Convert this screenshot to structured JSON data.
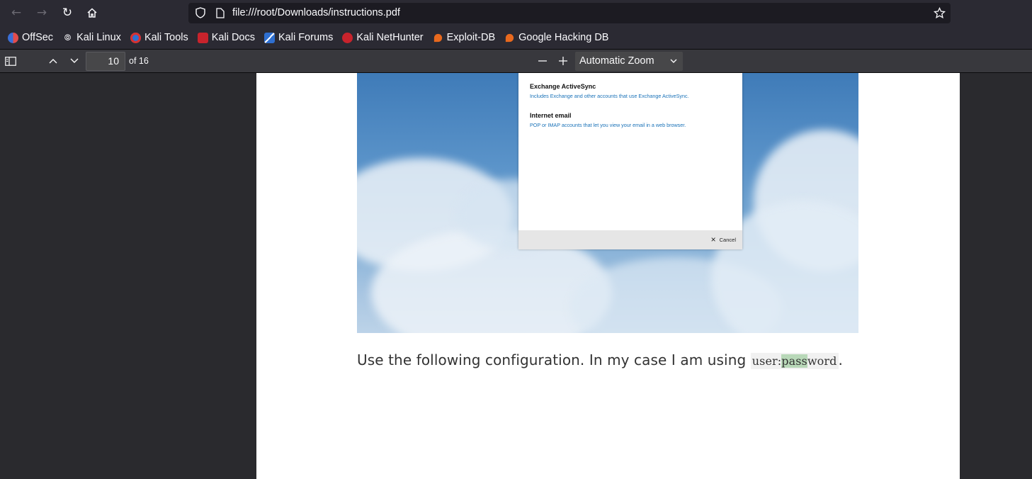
{
  "browser": {
    "url": "file:///root/Downloads/instructions.pdf",
    "bookmarks": [
      {
        "label": "OffSec",
        "color": "#3a6fd8"
      },
      {
        "label": "Kali Linux",
        "color": "#2b2a33"
      },
      {
        "label": "Kali Tools",
        "color": "#d8312f"
      },
      {
        "label": "Kali Docs",
        "color": "#c8232c"
      },
      {
        "label": "Kali Forums",
        "color": "#2f6fd0"
      },
      {
        "label": "Kali NetHunter",
        "color": "#c8232c"
      },
      {
        "label": "Exploit-DB",
        "color": "#e8691e"
      },
      {
        "label": "Google Hacking DB",
        "color": "#e8691e"
      }
    ]
  },
  "pdf_toolbar": {
    "page_number": "10",
    "page_count": "of 16",
    "zoom": "Automatic Zoom"
  },
  "document": {
    "dialog": {
      "option1_title": "Exchange ActiveSync",
      "option1_desc": "Includes Exchange and other accounts that use Exchange ActiveSync.",
      "option2_title": "Internet email",
      "option2_desc": "POP or IMAP accounts that let you view your email in a web browser.",
      "cancel_label": "Cancel"
    },
    "paragraph_text": "Use the following configuration. In my case I am using ",
    "code_prefix": "user:",
    "code_highlight": "pass",
    "code_suffix": "word",
    "paragraph_end": "."
  }
}
